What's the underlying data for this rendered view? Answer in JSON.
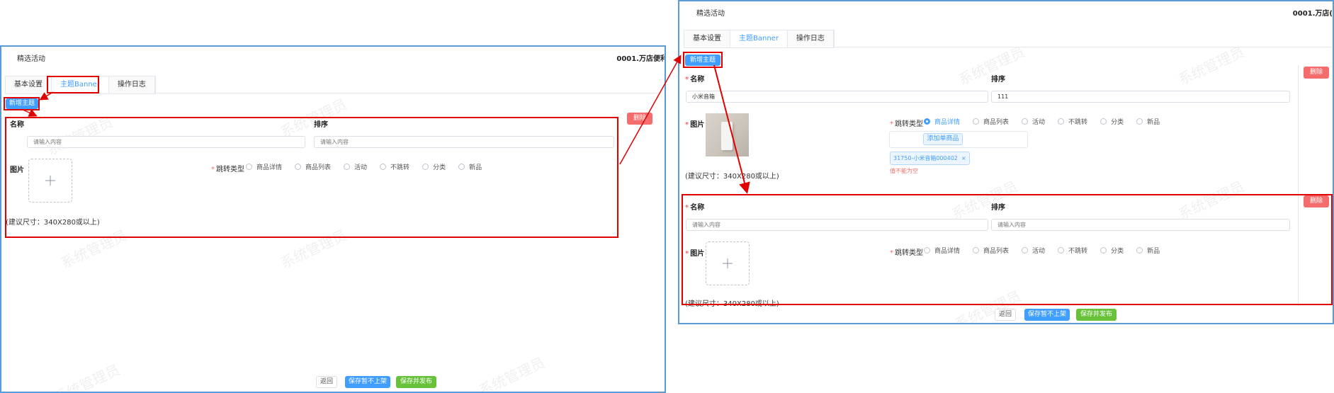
{
  "left_panel": {
    "header_title": "精选活动",
    "store_name": "0001.万店便利",
    "tabs": [
      "基本设置",
      "主题Banner",
      "操作日志"
    ],
    "add_theme_button": "新增主题",
    "theme": {
      "delete_button": "删除",
      "name_label": "名称",
      "sort_label": "排序",
      "name_placeholder": "请输入内容",
      "sort_placeholder": "请输入内容",
      "image_label": "图片",
      "size_hint": "(建议尺寸：340X280或以上)",
      "jump_type_label": "跳转类型",
      "jump_options": [
        "商品详情",
        "商品列表",
        "活动",
        "不跳转",
        "分类",
        "新品"
      ]
    },
    "footer": {
      "back_button": "返回",
      "save_button": "保存暂不上架",
      "save_publish_button": "保存并发布"
    }
  },
  "right_panel": {
    "header_title": "精选活动",
    "store_name": "0001.万店(",
    "tabs": [
      "基本设置",
      "主题Banner",
      "操作日志"
    ],
    "add_theme_button": "新增主题",
    "theme1": {
      "delete_button": "删除",
      "name_label": "名称",
      "sort_label": "排序",
      "name_value": "小米音箱",
      "sort_value": "111",
      "image_label": "图片",
      "size_hint": "(建议尺寸：340X280或以上)",
      "jump_type_label": "跳转类型",
      "jump_options": [
        "商品详情",
        "商品列表",
        "活动",
        "不跳转",
        "分类",
        "新品"
      ],
      "selected_option": "商品详情",
      "add_product_button": "添加单商品",
      "product_tag": "31750-小米音箱000402",
      "tag_close": "×",
      "error_text": "值不能为空"
    },
    "theme2": {
      "delete_button": "删除",
      "name_label": "名称",
      "sort_label": "排序",
      "name_placeholder": "请输入内容",
      "sort_placeholder": "请输入内容",
      "image_label": "图片",
      "size_hint": "(建议尺寸：340X280或以上)",
      "jump_type_label": "跳转类型",
      "jump_options": [
        "商品详情",
        "商品列表",
        "活动",
        "不跳转",
        "分类",
        "新品"
      ]
    },
    "footer": {
      "back_button": "返回",
      "save_button": "保存暂不上架",
      "save_publish_button": "保存并发布"
    }
  },
  "watermark_text": "系统管理员",
  "colors": {
    "frame_border": "#5b9bd5",
    "primary": "#409eff",
    "danger": "#f56c6c",
    "success": "#67c23a",
    "annotation_red": "#e00000"
  }
}
